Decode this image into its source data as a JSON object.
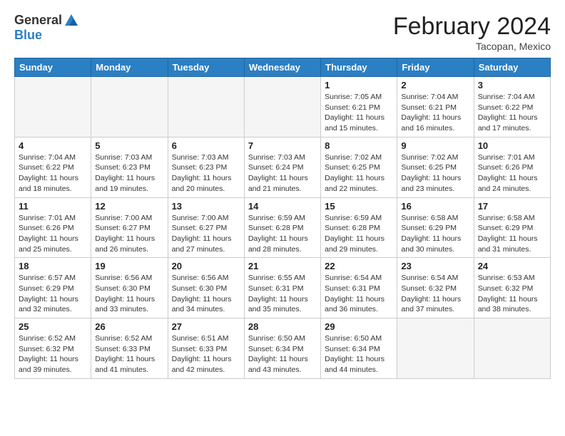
{
  "header": {
    "logo_general": "General",
    "logo_blue": "Blue",
    "month_title": "February 2024",
    "location": "Tacopan, Mexico"
  },
  "weekdays": [
    "Sunday",
    "Monday",
    "Tuesday",
    "Wednesday",
    "Thursday",
    "Friday",
    "Saturday"
  ],
  "weeks": [
    [
      {
        "day": "",
        "info": "",
        "empty": true
      },
      {
        "day": "",
        "info": "",
        "empty": true
      },
      {
        "day": "",
        "info": "",
        "empty": true
      },
      {
        "day": "",
        "info": "",
        "empty": true
      },
      {
        "day": "1",
        "info": "Sunrise: 7:05 AM\nSunset: 6:21 PM\nDaylight: 11 hours\nand 15 minutes.",
        "empty": false
      },
      {
        "day": "2",
        "info": "Sunrise: 7:04 AM\nSunset: 6:21 PM\nDaylight: 11 hours\nand 16 minutes.",
        "empty": false
      },
      {
        "day": "3",
        "info": "Sunrise: 7:04 AM\nSunset: 6:22 PM\nDaylight: 11 hours\nand 17 minutes.",
        "empty": false
      }
    ],
    [
      {
        "day": "4",
        "info": "Sunrise: 7:04 AM\nSunset: 6:22 PM\nDaylight: 11 hours\nand 18 minutes.",
        "empty": false
      },
      {
        "day": "5",
        "info": "Sunrise: 7:03 AM\nSunset: 6:23 PM\nDaylight: 11 hours\nand 19 minutes.",
        "empty": false
      },
      {
        "day": "6",
        "info": "Sunrise: 7:03 AM\nSunset: 6:23 PM\nDaylight: 11 hours\nand 20 minutes.",
        "empty": false
      },
      {
        "day": "7",
        "info": "Sunrise: 7:03 AM\nSunset: 6:24 PM\nDaylight: 11 hours\nand 21 minutes.",
        "empty": false
      },
      {
        "day": "8",
        "info": "Sunrise: 7:02 AM\nSunset: 6:25 PM\nDaylight: 11 hours\nand 22 minutes.",
        "empty": false
      },
      {
        "day": "9",
        "info": "Sunrise: 7:02 AM\nSunset: 6:25 PM\nDaylight: 11 hours\nand 23 minutes.",
        "empty": false
      },
      {
        "day": "10",
        "info": "Sunrise: 7:01 AM\nSunset: 6:26 PM\nDaylight: 11 hours\nand 24 minutes.",
        "empty": false
      }
    ],
    [
      {
        "day": "11",
        "info": "Sunrise: 7:01 AM\nSunset: 6:26 PM\nDaylight: 11 hours\nand 25 minutes.",
        "empty": false
      },
      {
        "day": "12",
        "info": "Sunrise: 7:00 AM\nSunset: 6:27 PM\nDaylight: 11 hours\nand 26 minutes.",
        "empty": false
      },
      {
        "day": "13",
        "info": "Sunrise: 7:00 AM\nSunset: 6:27 PM\nDaylight: 11 hours\nand 27 minutes.",
        "empty": false
      },
      {
        "day": "14",
        "info": "Sunrise: 6:59 AM\nSunset: 6:28 PM\nDaylight: 11 hours\nand 28 minutes.",
        "empty": false
      },
      {
        "day": "15",
        "info": "Sunrise: 6:59 AM\nSunset: 6:28 PM\nDaylight: 11 hours\nand 29 minutes.",
        "empty": false
      },
      {
        "day": "16",
        "info": "Sunrise: 6:58 AM\nSunset: 6:29 PM\nDaylight: 11 hours\nand 30 minutes.",
        "empty": false
      },
      {
        "day": "17",
        "info": "Sunrise: 6:58 AM\nSunset: 6:29 PM\nDaylight: 11 hours\nand 31 minutes.",
        "empty": false
      }
    ],
    [
      {
        "day": "18",
        "info": "Sunrise: 6:57 AM\nSunset: 6:29 PM\nDaylight: 11 hours\nand 32 minutes.",
        "empty": false
      },
      {
        "day": "19",
        "info": "Sunrise: 6:56 AM\nSunset: 6:30 PM\nDaylight: 11 hours\nand 33 minutes.",
        "empty": false
      },
      {
        "day": "20",
        "info": "Sunrise: 6:56 AM\nSunset: 6:30 PM\nDaylight: 11 hours\nand 34 minutes.",
        "empty": false
      },
      {
        "day": "21",
        "info": "Sunrise: 6:55 AM\nSunset: 6:31 PM\nDaylight: 11 hours\nand 35 minutes.",
        "empty": false
      },
      {
        "day": "22",
        "info": "Sunrise: 6:54 AM\nSunset: 6:31 PM\nDaylight: 11 hours\nand 36 minutes.",
        "empty": false
      },
      {
        "day": "23",
        "info": "Sunrise: 6:54 AM\nSunset: 6:32 PM\nDaylight: 11 hours\nand 37 minutes.",
        "empty": false
      },
      {
        "day": "24",
        "info": "Sunrise: 6:53 AM\nSunset: 6:32 PM\nDaylight: 11 hours\nand 38 minutes.",
        "empty": false
      }
    ],
    [
      {
        "day": "25",
        "info": "Sunrise: 6:52 AM\nSunset: 6:32 PM\nDaylight: 11 hours\nand 39 minutes.",
        "empty": false
      },
      {
        "day": "26",
        "info": "Sunrise: 6:52 AM\nSunset: 6:33 PM\nDaylight: 11 hours\nand 41 minutes.",
        "empty": false
      },
      {
        "day": "27",
        "info": "Sunrise: 6:51 AM\nSunset: 6:33 PM\nDaylight: 11 hours\nand 42 minutes.",
        "empty": false
      },
      {
        "day": "28",
        "info": "Sunrise: 6:50 AM\nSunset: 6:34 PM\nDaylight: 11 hours\nand 43 minutes.",
        "empty": false
      },
      {
        "day": "29",
        "info": "Sunrise: 6:50 AM\nSunset: 6:34 PM\nDaylight: 11 hours\nand 44 minutes.",
        "empty": false
      },
      {
        "day": "",
        "info": "",
        "empty": true
      },
      {
        "day": "",
        "info": "",
        "empty": true
      }
    ]
  ]
}
